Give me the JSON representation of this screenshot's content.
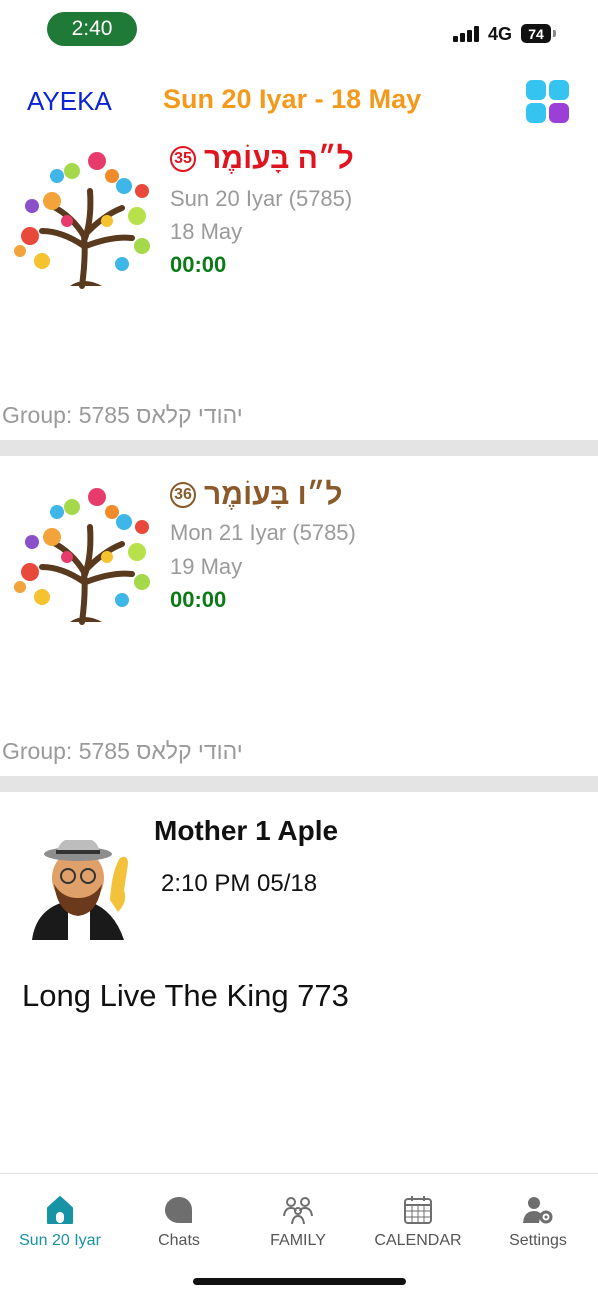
{
  "status": {
    "time": "2:40",
    "network": "4G",
    "battery": "74"
  },
  "header": {
    "app_name": "AYEKA",
    "date": "Sun 20 Iyar - 18 May"
  },
  "cards": [
    {
      "omer_text": "ל״ה בָּעוֹמֶר",
      "omer_number": "35",
      "hebrew_date": "Sun 20 Iyar (5785)",
      "greg_date": "18 May",
      "time": "00:00",
      "group": "Group: 5785 יהודי קלאס",
      "accent": "#e0141e"
    },
    {
      "omer_text": "ל״ו בָּעוֹמֶר",
      "omer_number": "36",
      "hebrew_date": "Mon 21 Iyar (5785)",
      "greg_date": "19 May",
      "time": "00:00",
      "group": "Group: 5785 יהודי קלאס",
      "accent": "#8a5a2b"
    }
  ],
  "message": {
    "author": "Mother 1 Aple",
    "timestamp": "2:10 PM 05/18",
    "text": "Long Live The King 773"
  },
  "tabs": [
    {
      "label": "Sun 20 Iyar",
      "icon": "home-icon",
      "active": true
    },
    {
      "label": "Chats",
      "icon": "chat-bubble-icon"
    },
    {
      "label": "FAMILY",
      "icon": "family-icon"
    },
    {
      "label": "CALENDAR",
      "icon": "calendar-icon"
    },
    {
      "label": "Settings",
      "icon": "settings-icon"
    }
  ],
  "colors": {
    "accent_blue": "#0b24d6",
    "accent_orange": "#f39a1c",
    "active_tab": "#1793a6",
    "time_green": "#0c7a17"
  }
}
